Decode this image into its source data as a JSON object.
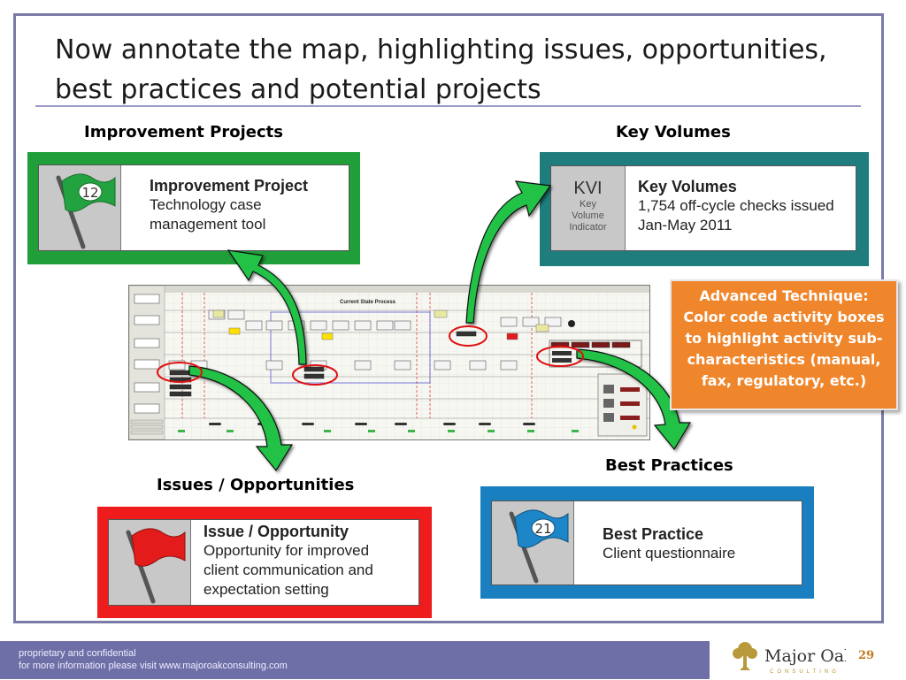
{
  "slide": {
    "title": "Now annotate the map, highlighting issues, opportunities, best practices and potential projects",
    "page_number": "29"
  },
  "labels": {
    "improvement_projects": "Improvement Projects",
    "key_volumes": "Key Volumes",
    "issues_opportunities": "Issues / Opportunities",
    "best_practices": "Best Practices"
  },
  "cards": {
    "improvement": {
      "flag_number": "12",
      "heading": "Improvement Project",
      "body": "Technology case management tool",
      "color": "#1f9e3a"
    },
    "key_volumes": {
      "kvi": "KVI",
      "kvi_caption": "Key Volume Indicator",
      "heading": "Key Volumes",
      "body": "1,754 off-cycle checks issued Jan-May 2011",
      "color": "#1f7d7d"
    },
    "issue": {
      "heading": "Issue / Opportunity",
      "body": "Opportunity for improved client communication and expectation setting",
      "color": "#ee1c1c"
    },
    "best_practice": {
      "flag_number": "21",
      "heading": "Best Practice",
      "body": "Client questionnaire",
      "color": "#1a7fc1"
    }
  },
  "process_map": {
    "title": "Current State Process"
  },
  "callout": {
    "text": "Advanced Technique: Color code activity boxes to highlight activity sub-characteristics (manual, fax, regulatory, etc.)"
  },
  "footer": {
    "line1": "proprietary and confidential",
    "line2": "for more information please visit www.majoroakconsulting.com",
    "logo_main": "Major Oak",
    "logo_sub": "CONSULTING"
  },
  "colors": {
    "frame": "#7a7aa8",
    "footer": "#6f6fa8",
    "arrow": "#22c247",
    "callout": "#f0862b"
  }
}
